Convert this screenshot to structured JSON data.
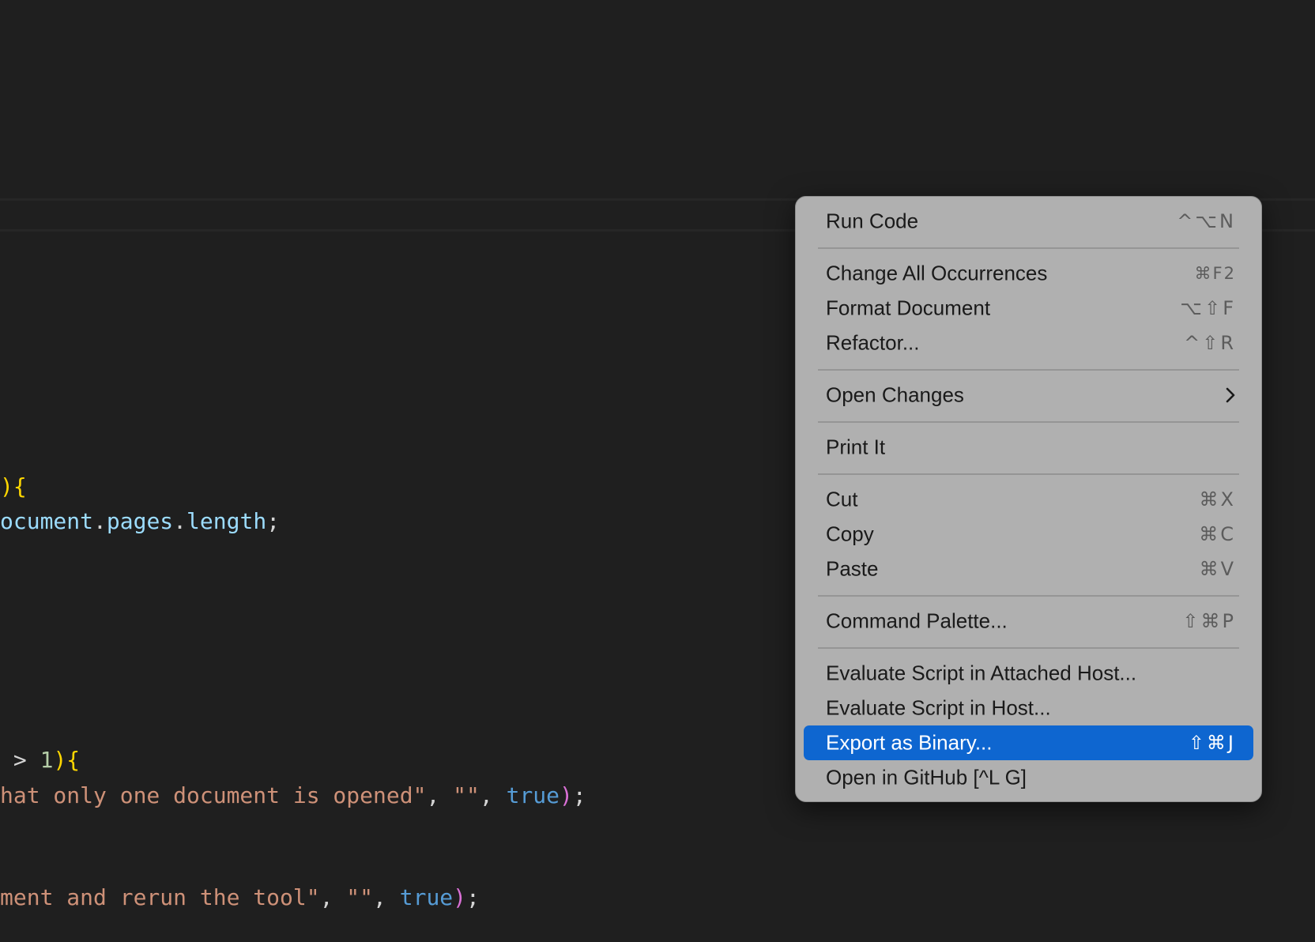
{
  "code": {
    "line1": {
      "brace": "){"
    },
    "line2": {
      "a": "ocument",
      "dot1": ".",
      "b": "pages",
      "dot2": ".",
      "c": "length",
      "semi": ";"
    },
    "line3": {
      "gt": " > ",
      "num": "1",
      "close": ")",
      "brace": "{"
    },
    "line4": {
      "str": "hat only one document is opened\"",
      "comma1": ", ",
      "empty": "\"\"",
      "comma2": ", ",
      "kw": "true",
      "close": ")",
      "semi": ";"
    },
    "line5": {
      "str": "ment and rerun the tool\"",
      "comma1": ", ",
      "empty": "\"\"",
      "comma2": ", ",
      "kw": "true",
      "close": ")",
      "semi": ";"
    }
  },
  "menu": {
    "items": [
      {
        "label": "Run Code",
        "shortcut": "^⌥N"
      },
      {
        "label": "Change All Occurrences",
        "shortcut": "⌘F2"
      },
      {
        "label": "Format Document",
        "shortcut": "⌥⇧F"
      },
      {
        "label": "Refactor...",
        "shortcut": "^⇧R"
      },
      {
        "label": "Open Changes",
        "shortcut": ""
      },
      {
        "label": "Print It",
        "shortcut": ""
      },
      {
        "label": "Cut",
        "shortcut": "⌘X"
      },
      {
        "label": "Copy",
        "shortcut": "⌘C"
      },
      {
        "label": "Paste",
        "shortcut": "⌘V"
      },
      {
        "label": "Command Palette...",
        "shortcut": "⇧⌘P"
      },
      {
        "label": "Evaluate Script in Attached Host...",
        "shortcut": ""
      },
      {
        "label": "Evaluate Script in Host...",
        "shortcut": ""
      },
      {
        "label": "Export as Binary...",
        "shortcut": "⇧⌘J"
      },
      {
        "label": "Open in GitHub [^L G]",
        "shortcut": ""
      }
    ],
    "highlighted_label": "Export as Binary...",
    "submenu_icon": "chevron-right-icon"
  },
  "colors": {
    "background": "#1f1f1f",
    "menu_background": "#b0b0b0",
    "highlight": "#0e66d0"
  }
}
